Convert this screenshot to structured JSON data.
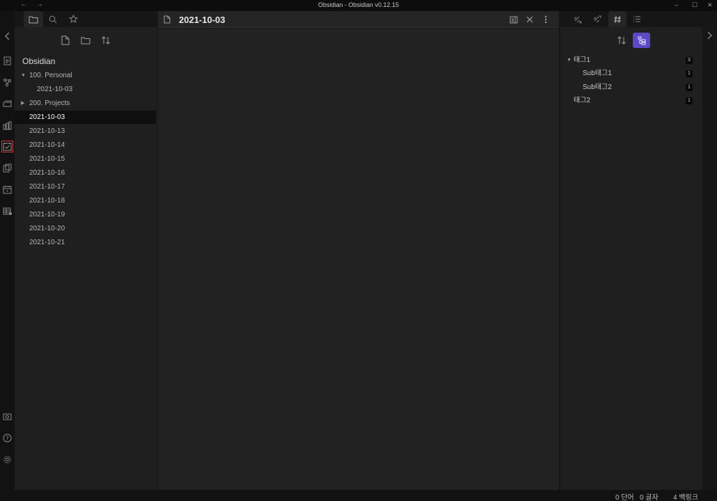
{
  "window": {
    "title": "Obsidian - Obsidian v0.12.15",
    "back_glyph": "←",
    "forward_glyph": "→",
    "minimize_glyph": "–",
    "maximize_glyph": "☐",
    "close_glyph": "✕"
  },
  "ribbon": {
    "items": [
      {
        "icon": "open-quick-switcher-icon"
      },
      {
        "icon": "graph-view-icon"
      },
      {
        "icon": "open-random-note-icon"
      },
      {
        "icon": "kanban-icon"
      },
      {
        "icon": "daily-note-calendar-icon",
        "active": true
      },
      {
        "icon": "templates-icon"
      },
      {
        "icon": "calendar-icon"
      },
      {
        "icon": "table-icon"
      }
    ],
    "bottom": [
      {
        "icon": "open-another-vault-icon"
      },
      {
        "icon": "help-icon"
      },
      {
        "icon": "settings-icon"
      }
    ]
  },
  "left_sidebar": {
    "tabs": [
      {
        "icon": "folder-icon",
        "active": true
      },
      {
        "icon": "search-icon"
      },
      {
        "icon": "star-icon"
      }
    ],
    "actions": [
      {
        "icon": "new-note-icon"
      },
      {
        "icon": "new-folder-icon"
      },
      {
        "icon": "sort-icon"
      }
    ],
    "vault_name": "Obsidian",
    "tree": [
      {
        "label": "100. Personal",
        "type": "folder",
        "expanded": true,
        "depth": 0
      },
      {
        "label": "2021-10-03",
        "type": "file",
        "depth": 1
      },
      {
        "label": "200. Projects",
        "type": "folder",
        "expanded": false,
        "depth": 0
      },
      {
        "label": "2021-10-03",
        "type": "file",
        "depth": 0,
        "active": true
      },
      {
        "label": "2021-10-13",
        "type": "file",
        "depth": 0
      },
      {
        "label": "2021-10-14",
        "type": "file",
        "depth": 0
      },
      {
        "label": "2021-10-15",
        "type": "file",
        "depth": 0
      },
      {
        "label": "2021-10-16",
        "type": "file",
        "depth": 0
      },
      {
        "label": "2021-10-17",
        "type": "file",
        "depth": 0
      },
      {
        "label": "2021-10-18",
        "type": "file",
        "depth": 0
      },
      {
        "label": "2021-10-19",
        "type": "file",
        "depth": 0
      },
      {
        "label": "2021-10-20",
        "type": "file",
        "depth": 0
      },
      {
        "label": "2021-10-21",
        "type": "file",
        "depth": 0
      }
    ]
  },
  "editor": {
    "title": "2021-10-03",
    "doc_icon": "document-icon",
    "actions": [
      {
        "icon": "reading-view-icon"
      },
      {
        "icon": "close-icon"
      },
      {
        "icon": "more-options-icon"
      }
    ]
  },
  "right_sidebar": {
    "tabs": [
      {
        "icon": "backlinks-icon"
      },
      {
        "icon": "outgoing-links-icon"
      },
      {
        "icon": "tag-hash-icon",
        "active": true
      },
      {
        "icon": "outline-icon"
      }
    ],
    "actions": [
      {
        "icon": "sort-icon"
      },
      {
        "icon": "tree-view-icon",
        "active": true
      }
    ],
    "tags": [
      {
        "label": "태그1",
        "count": "3",
        "depth": 0,
        "expanded": true
      },
      {
        "label": "Sub태그1",
        "count": "1",
        "depth": 1
      },
      {
        "label": "Sub태그2",
        "count": "1",
        "depth": 1
      },
      {
        "label": "태그2",
        "count": "1",
        "depth": 0
      }
    ]
  },
  "statusbar": {
    "words": "0 단어",
    "chars": "0 글자",
    "backlinks": "4 백링크"
  },
  "colors": {
    "accent": "#5a4bc4",
    "active_outline": "#d83a3a"
  }
}
